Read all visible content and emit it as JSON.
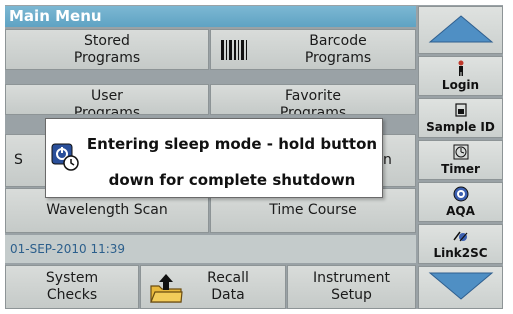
{
  "header": {
    "title": "Main Menu"
  },
  "menu": {
    "stored_programs": "Stored\nPrograms",
    "barcode_programs": "Barcode\nPrograms",
    "user_programs": "User\nPrograms",
    "favorite_programs": "Favorite\nPrograms",
    "row3_left_partial": "S",
    "row3_right_partial": "n",
    "wavelength_scan": "Wavelength Scan",
    "time_course": "Time Course"
  },
  "status": {
    "datetime": "01-SEP-2010 11:39"
  },
  "bottom": {
    "system_checks": "System\nChecks",
    "recall_data": "Recall\nData",
    "instrument_setup": "Instrument\nSetup"
  },
  "sidebar": {
    "login": "Login",
    "sample_id": "Sample ID",
    "timer": "Timer",
    "aqa": "AQA",
    "link2sc": "Link2SC"
  },
  "dialog": {
    "line1": "Entering sleep mode - hold button",
    "line2": "down for complete shutdown"
  },
  "colors": {
    "title_bar": "#6aaccb",
    "arrow_blue": "#4f8fc4",
    "date_text": "#2c5f8c"
  },
  "icons": [
    "barcode-icon",
    "folder-upload-icon",
    "person-icon",
    "sample-id-icon",
    "timer-icon",
    "aqa-icon",
    "link2sc-icon",
    "power-icon",
    "arrow-up-icon",
    "arrow-down-icon"
  ]
}
